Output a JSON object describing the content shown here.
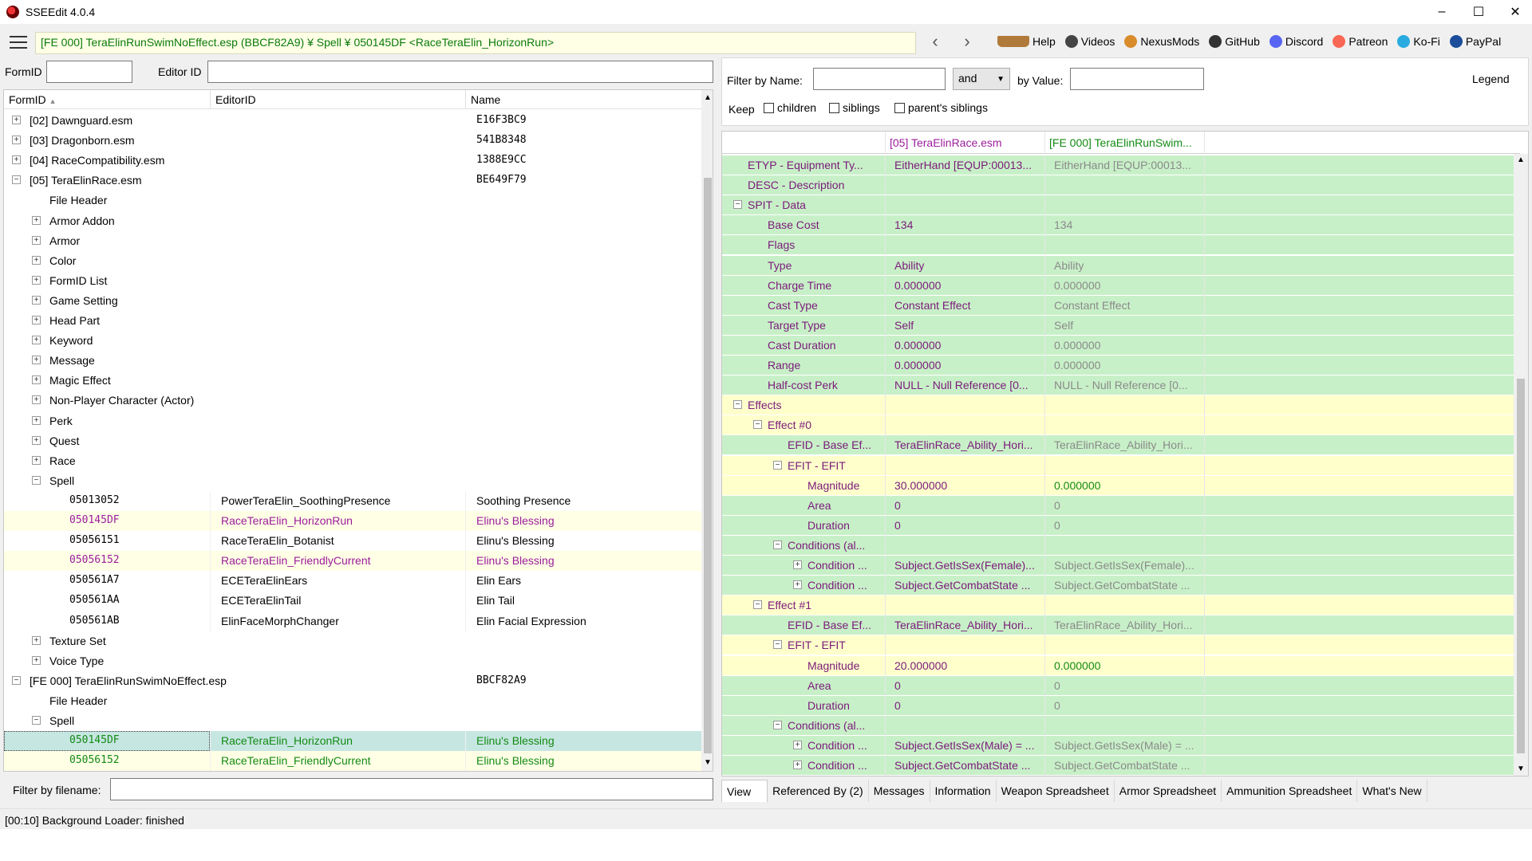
{
  "window": {
    "title": "SSEEdit 4.0.4",
    "min": "–",
    "max": "☐",
    "close": "✕"
  },
  "toolbar": {
    "path": "[FE 000] TeraElinRunSwimNoEffect.esp (BBCF82A9) ¥ Spell ¥ 050145DF <RaceTeraElin_HorizonRun>",
    "back": "‹",
    "forward": "›",
    "links": [
      {
        "label": "Help",
        "icon": "book-icon",
        "color": "#b07a3a"
      },
      {
        "label": "Videos",
        "icon": "videos-icon",
        "color": "#444444"
      },
      {
        "label": "NexusMods",
        "icon": "nexusmods-icon",
        "color": "#d98c2b"
      },
      {
        "label": "GitHub",
        "icon": "github-icon",
        "color": "#333333"
      },
      {
        "label": "Discord",
        "icon": "discord-icon",
        "color": "#5865f2"
      },
      {
        "label": "Patreon",
        "icon": "patreon-icon",
        "color": "#f96854"
      },
      {
        "label": "Ko-Fi",
        "icon": "kofi-icon",
        "color": "#29abe0"
      },
      {
        "label": "PayPal",
        "icon": "paypal-icon",
        "color": "#1b4d9b"
      }
    ]
  },
  "left": {
    "formid_label": "FormID",
    "editorid_label": "Editor ID",
    "columns": {
      "formid": "FormID",
      "editorid": "EditorID",
      "name": "Name"
    },
    "sort_glyph": "▲",
    "filter_filename_label": "Filter by filename:",
    "rows": [
      {
        "level": 0,
        "exp": "+",
        "text": "[02] Dawnguard.esm",
        "name": "E16F3BC9"
      },
      {
        "level": 0,
        "exp": "+",
        "text": "[03] Dragonborn.esm",
        "name": "541B8348"
      },
      {
        "level": 0,
        "exp": "+",
        "text": "[04] RaceCompatibility.esm",
        "name": "1388E9CC"
      },
      {
        "level": 0,
        "exp": "−",
        "text": "[05] TeraElinRace.esm",
        "name": "BE649F79"
      },
      {
        "level": 1,
        "exp": "",
        "text": "File Header",
        "name": ""
      },
      {
        "level": 1,
        "exp": "+",
        "text": "Armor Addon",
        "name": ""
      },
      {
        "level": 1,
        "exp": "+",
        "text": "Armor",
        "name": ""
      },
      {
        "level": 1,
        "exp": "+",
        "text": "Color",
        "name": ""
      },
      {
        "level": 1,
        "exp": "+",
        "text": "FormID List",
        "name": ""
      },
      {
        "level": 1,
        "exp": "+",
        "text": "Game Setting",
        "name": ""
      },
      {
        "level": 1,
        "exp": "+",
        "text": "Head Part",
        "name": ""
      },
      {
        "level": 1,
        "exp": "+",
        "text": "Keyword",
        "name": ""
      },
      {
        "level": 1,
        "exp": "+",
        "text": "Message",
        "name": ""
      },
      {
        "level": 1,
        "exp": "+",
        "text": "Magic Effect",
        "name": ""
      },
      {
        "level": 1,
        "exp": "+",
        "text": "Non-Player Character (Actor)",
        "name": ""
      },
      {
        "level": 1,
        "exp": "+",
        "text": "Perk",
        "name": ""
      },
      {
        "level": 1,
        "exp": "+",
        "text": "Quest",
        "name": ""
      },
      {
        "level": 1,
        "exp": "+",
        "text": "Race",
        "name": ""
      },
      {
        "level": 1,
        "exp": "−",
        "text": "Spell",
        "name": ""
      },
      {
        "level": 2,
        "exp": "",
        "formid": "05013052",
        "editorid": "PowerTeraElin_SoothingPresence",
        "name": "Soothing Presence",
        "style": "normal"
      },
      {
        "level": 2,
        "exp": "",
        "formid": "050145DF",
        "editorid": "RaceTeraElin_HorizonRun",
        "name": "Elinu's Blessing",
        "style": "purple-hl"
      },
      {
        "level": 2,
        "exp": "",
        "formid": "05056151",
        "editorid": "RaceTeraElin_Botanist",
        "name": "Elinu's Blessing",
        "style": "normal"
      },
      {
        "level": 2,
        "exp": "",
        "formid": "05056152",
        "editorid": "RaceTeraElin_FriendlyCurrent",
        "name": "Elinu's Blessing",
        "style": "purple-hl"
      },
      {
        "level": 2,
        "exp": "",
        "formid": "050561A7",
        "editorid": "ECETeraElinEars",
        "name": "Elin Ears",
        "style": "normal"
      },
      {
        "level": 2,
        "exp": "",
        "formid": "050561AA",
        "editorid": "ECETeraElinTail",
        "name": "Elin Tail",
        "style": "normal"
      },
      {
        "level": 2,
        "exp": "",
        "formid": "050561AB",
        "editorid": "ElinFaceMorphChanger",
        "name": "Elin Facial Expression",
        "style": "normal"
      },
      {
        "level": 1,
        "exp": "+",
        "text": "Texture Set",
        "name": ""
      },
      {
        "level": 1,
        "exp": "+",
        "text": "Voice Type",
        "name": ""
      },
      {
        "level": 0,
        "exp": "−",
        "text": "[FE 000] TeraElinRunSwimNoEffect.esp",
        "name": "BBCF82A9"
      },
      {
        "level": 1,
        "exp": "",
        "text": "File Header",
        "name": ""
      },
      {
        "level": 1,
        "exp": "−",
        "text": "Spell",
        "name": ""
      },
      {
        "level": 2,
        "exp": "",
        "formid": "050145DF",
        "editorid": "RaceTeraElin_HorizonRun",
        "name": "Elinu's Blessing",
        "style": "green-sel"
      },
      {
        "level": 2,
        "exp": "",
        "formid": "05056152",
        "editorid": "RaceTeraElin_FriendlyCurrent",
        "name": "Elinu's Blessing",
        "style": "green-hl"
      }
    ]
  },
  "right": {
    "filter_name_label": "Filter by Name:",
    "and_select": "and",
    "by_value_label": "by Value:",
    "legend": "Legend",
    "keep_label": "Keep",
    "keep_children": "children",
    "keep_siblings": "siblings",
    "keep_parents_siblings": "parent's siblings",
    "col1": "[05] TeraElinRace.esm",
    "col2": "[FE 000] TeraElinRunSwim...",
    "rows": [
      {
        "level": 0,
        "exp": "",
        "label": "ETYP - Equipment Ty...",
        "v1": "EitherHand [EQUP:00013...",
        "v2": "EitherHand [EQUP:00013...",
        "bg": "g",
        "v2c": "gray"
      },
      {
        "level": 0,
        "exp": "",
        "label": "DESC - Description",
        "v1": "",
        "v2": "",
        "bg": "g",
        "v2c": "gray"
      },
      {
        "level": 0,
        "exp": "−",
        "label": "SPIT - Data",
        "v1": "",
        "v2": "",
        "bg": "g",
        "v2c": "gray"
      },
      {
        "level": 1,
        "exp": "",
        "label": "Base Cost",
        "v1": "134",
        "v2": "134",
        "bg": "g",
        "v2c": "gray"
      },
      {
        "level": 1,
        "exp": "",
        "label": "Flags",
        "v1": "",
        "v2": "",
        "bg": "g",
        "v2c": "gray"
      },
      {
        "level": 1,
        "exp": "",
        "label": "Type",
        "v1": "Ability",
        "v2": "Ability",
        "bg": "g",
        "v2c": "gray"
      },
      {
        "level": 1,
        "exp": "",
        "label": "Charge Time",
        "v1": "0.000000",
        "v2": "0.000000",
        "bg": "g",
        "v2c": "gray"
      },
      {
        "level": 1,
        "exp": "",
        "label": "Cast Type",
        "v1": "Constant Effect",
        "v2": "Constant Effect",
        "bg": "g",
        "v2c": "gray"
      },
      {
        "level": 1,
        "exp": "",
        "label": "Target Type",
        "v1": "Self",
        "v2": "Self",
        "bg": "g",
        "v2c": "gray"
      },
      {
        "level": 1,
        "exp": "",
        "label": "Cast Duration",
        "v1": "0.000000",
        "v2": "0.000000",
        "bg": "g",
        "v2c": "gray"
      },
      {
        "level": 1,
        "exp": "",
        "label": "Range",
        "v1": "0.000000",
        "v2": "0.000000",
        "bg": "g",
        "v2c": "gray"
      },
      {
        "level": 1,
        "exp": "",
        "label": "Half-cost Perk",
        "v1": "NULL - Null Reference [0...",
        "v2": "NULL - Null Reference [0...",
        "bg": "g",
        "v2c": "gray"
      },
      {
        "level": 0,
        "exp": "−",
        "label": "Effects",
        "v1": "",
        "v2": "",
        "bg": "y",
        "v2c": "gray"
      },
      {
        "level": 1,
        "exp": "−",
        "label": "Effect #0",
        "v1": "",
        "v2": "",
        "bg": "y",
        "v2c": "gray"
      },
      {
        "level": 2,
        "exp": "",
        "label": "EFID - Base Ef...",
        "v1": "TeraElinRace_Ability_Hori...",
        "v2": "TeraElinRace_Ability_Hori...",
        "bg": "g",
        "v2c": "gray"
      },
      {
        "level": 2,
        "exp": "−",
        "label": "EFIT - EFIT",
        "v1": "",
        "v2": "",
        "bg": "y",
        "v2c": "gray"
      },
      {
        "level": 3,
        "exp": "",
        "label": "Magnitude",
        "v1": "30.000000",
        "v2": "0.000000",
        "bg": "y",
        "v2c": "green"
      },
      {
        "level": 3,
        "exp": "",
        "label": "Area",
        "v1": "0",
        "v2": "0",
        "bg": "g",
        "v2c": "gray"
      },
      {
        "level": 3,
        "exp": "",
        "label": "Duration",
        "v1": "0",
        "v2": "0",
        "bg": "g",
        "v2c": "gray"
      },
      {
        "level": 2,
        "exp": "−",
        "label": "Conditions (al...",
        "v1": "",
        "v2": "",
        "bg": "g",
        "v2c": "gray"
      },
      {
        "level": 3,
        "exp": "+",
        "label": "Condition ...",
        "v1": "Subject.GetIsSex(Female)...",
        "v2": "Subject.GetIsSex(Female)...",
        "bg": "g",
        "v2c": "gray"
      },
      {
        "level": 3,
        "exp": "+",
        "label": "Condition ...",
        "v1": "Subject.GetCombatState ...",
        "v2": "Subject.GetCombatState ...",
        "bg": "g",
        "v2c": "gray"
      },
      {
        "level": 1,
        "exp": "−",
        "label": "Effect #1",
        "v1": "",
        "v2": "",
        "bg": "y",
        "v2c": "gray"
      },
      {
        "level": 2,
        "exp": "",
        "label": "EFID - Base Ef...",
        "v1": "TeraElinRace_Ability_Hori...",
        "v2": "TeraElinRace_Ability_Hori...",
        "bg": "g",
        "v2c": "gray"
      },
      {
        "level": 2,
        "exp": "−",
        "label": "EFIT - EFIT",
        "v1": "",
        "v2": "",
        "bg": "y",
        "v2c": "gray"
      },
      {
        "level": 3,
        "exp": "",
        "label": "Magnitude",
        "v1": "20.000000",
        "v2": "0.000000",
        "bg": "y",
        "v2c": "green"
      },
      {
        "level": 3,
        "exp": "",
        "label": "Area",
        "v1": "0",
        "v2": "0",
        "bg": "g",
        "v2c": "gray"
      },
      {
        "level": 3,
        "exp": "",
        "label": "Duration",
        "v1": "0",
        "v2": "0",
        "bg": "g",
        "v2c": "gray"
      },
      {
        "level": 2,
        "exp": "−",
        "label": "Conditions (al...",
        "v1": "",
        "v2": "",
        "bg": "g",
        "v2c": "gray"
      },
      {
        "level": 3,
        "exp": "+",
        "label": "Condition ...",
        "v1": "Subject.GetIsSex(Male) = ...",
        "v2": "Subject.GetIsSex(Male) = ...",
        "bg": "g",
        "v2c": "gray"
      },
      {
        "level": 3,
        "exp": "+",
        "label": "Condition ...",
        "v1": "Subject.GetCombatState ...",
        "v2": "Subject.GetCombatState ...",
        "bg": "g",
        "v2c": "gray"
      }
    ],
    "tabs": [
      "View",
      "Referenced By (2)",
      "Messages",
      "Information",
      "Weapon Spreadsheet",
      "Armor Spreadsheet",
      "Ammunition Spreadsheet",
      "What's New"
    ]
  },
  "status": "[00:10] Background Loader: finished"
}
